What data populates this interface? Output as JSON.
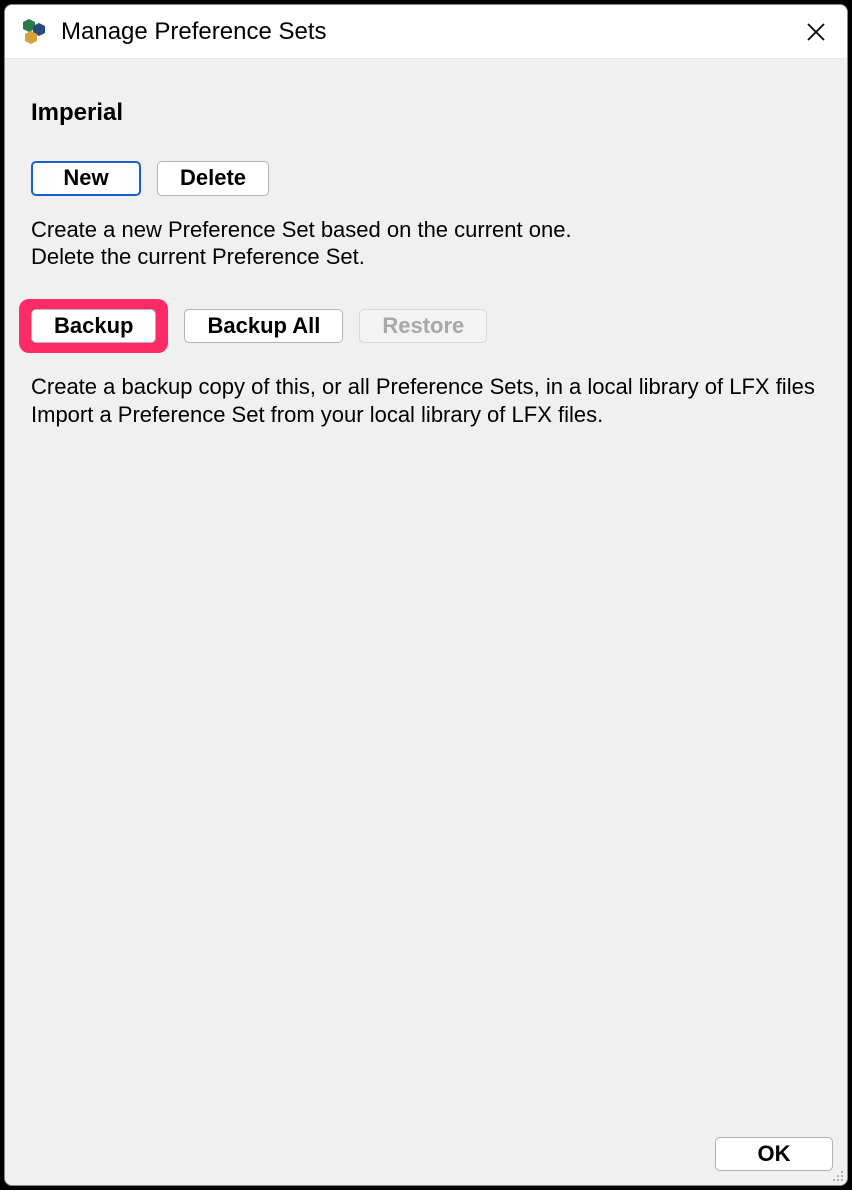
{
  "window": {
    "title": "Manage Preference Sets"
  },
  "content": {
    "set_name": "Imperial",
    "buttons": {
      "new": "New",
      "delete": "Delete",
      "backup": "Backup",
      "backup_all": "Backup All",
      "restore": "Restore"
    },
    "desc1_line1": "Create a new Preference Set based on the current one.",
    "desc1_line2": "Delete the current Preference Set.",
    "desc2_line1": "Create a backup copy of this, or all Preference Sets, in a local library of LFX files",
    "desc2_line2": "Import a Preference Set from your local library of LFX files."
  },
  "footer": {
    "ok": "OK"
  }
}
